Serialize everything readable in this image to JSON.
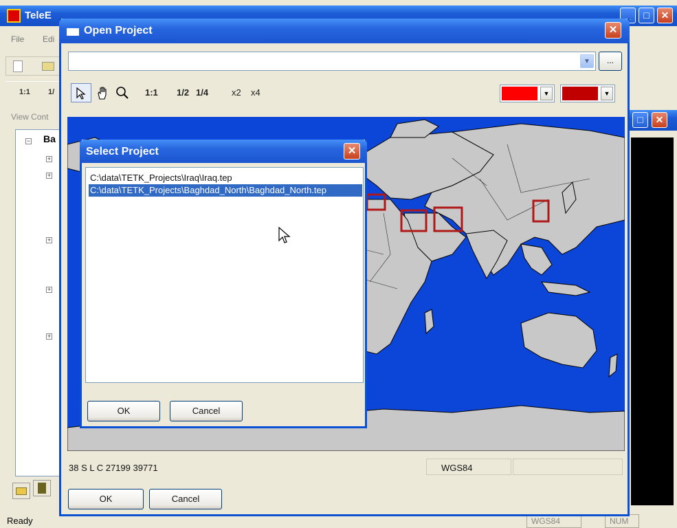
{
  "main_window": {
    "title": "TeleE",
    "menu": [
      "File",
      "Edi"
    ],
    "zoom_labels": [
      "1:1",
      "1/"
    ],
    "view_panel_label": "View Cont",
    "tree_root_label": "Ba",
    "status_ready": "Ready",
    "status_cells": [
      "WGS84",
      "NUM"
    ]
  },
  "open_dialog": {
    "title": "Open Project",
    "path_value": "",
    "browse_label": "...",
    "tools": {
      "zoom_1_1": "1:1",
      "zoom_1_2": "1/2",
      "zoom_1_4": "1/4",
      "zoom_x2": "x2",
      "zoom_x4": "x4"
    },
    "fill_color": "#ff0000",
    "outline_color": "#c00000",
    "coordinate_readout": "38 S L C 27199 39771",
    "datum": "WGS84",
    "ok_label": "OK",
    "cancel_label": "Cancel"
  },
  "select_dialog": {
    "title": "Select Project",
    "items": [
      "C:\\data\\TETK_Projects\\Iraq\\Iraq.tep",
      "C:\\data\\TETK_Projects\\Baghdad_North\\Baghdad_North.tep"
    ],
    "selected_index": 1,
    "ok_label": "OK",
    "cancel_label": "Cancel"
  },
  "colors": {
    "ocean": "#0b46d8",
    "land": "#c8c8c8",
    "project_box": "#b01818",
    "selection": "#316ac5"
  }
}
